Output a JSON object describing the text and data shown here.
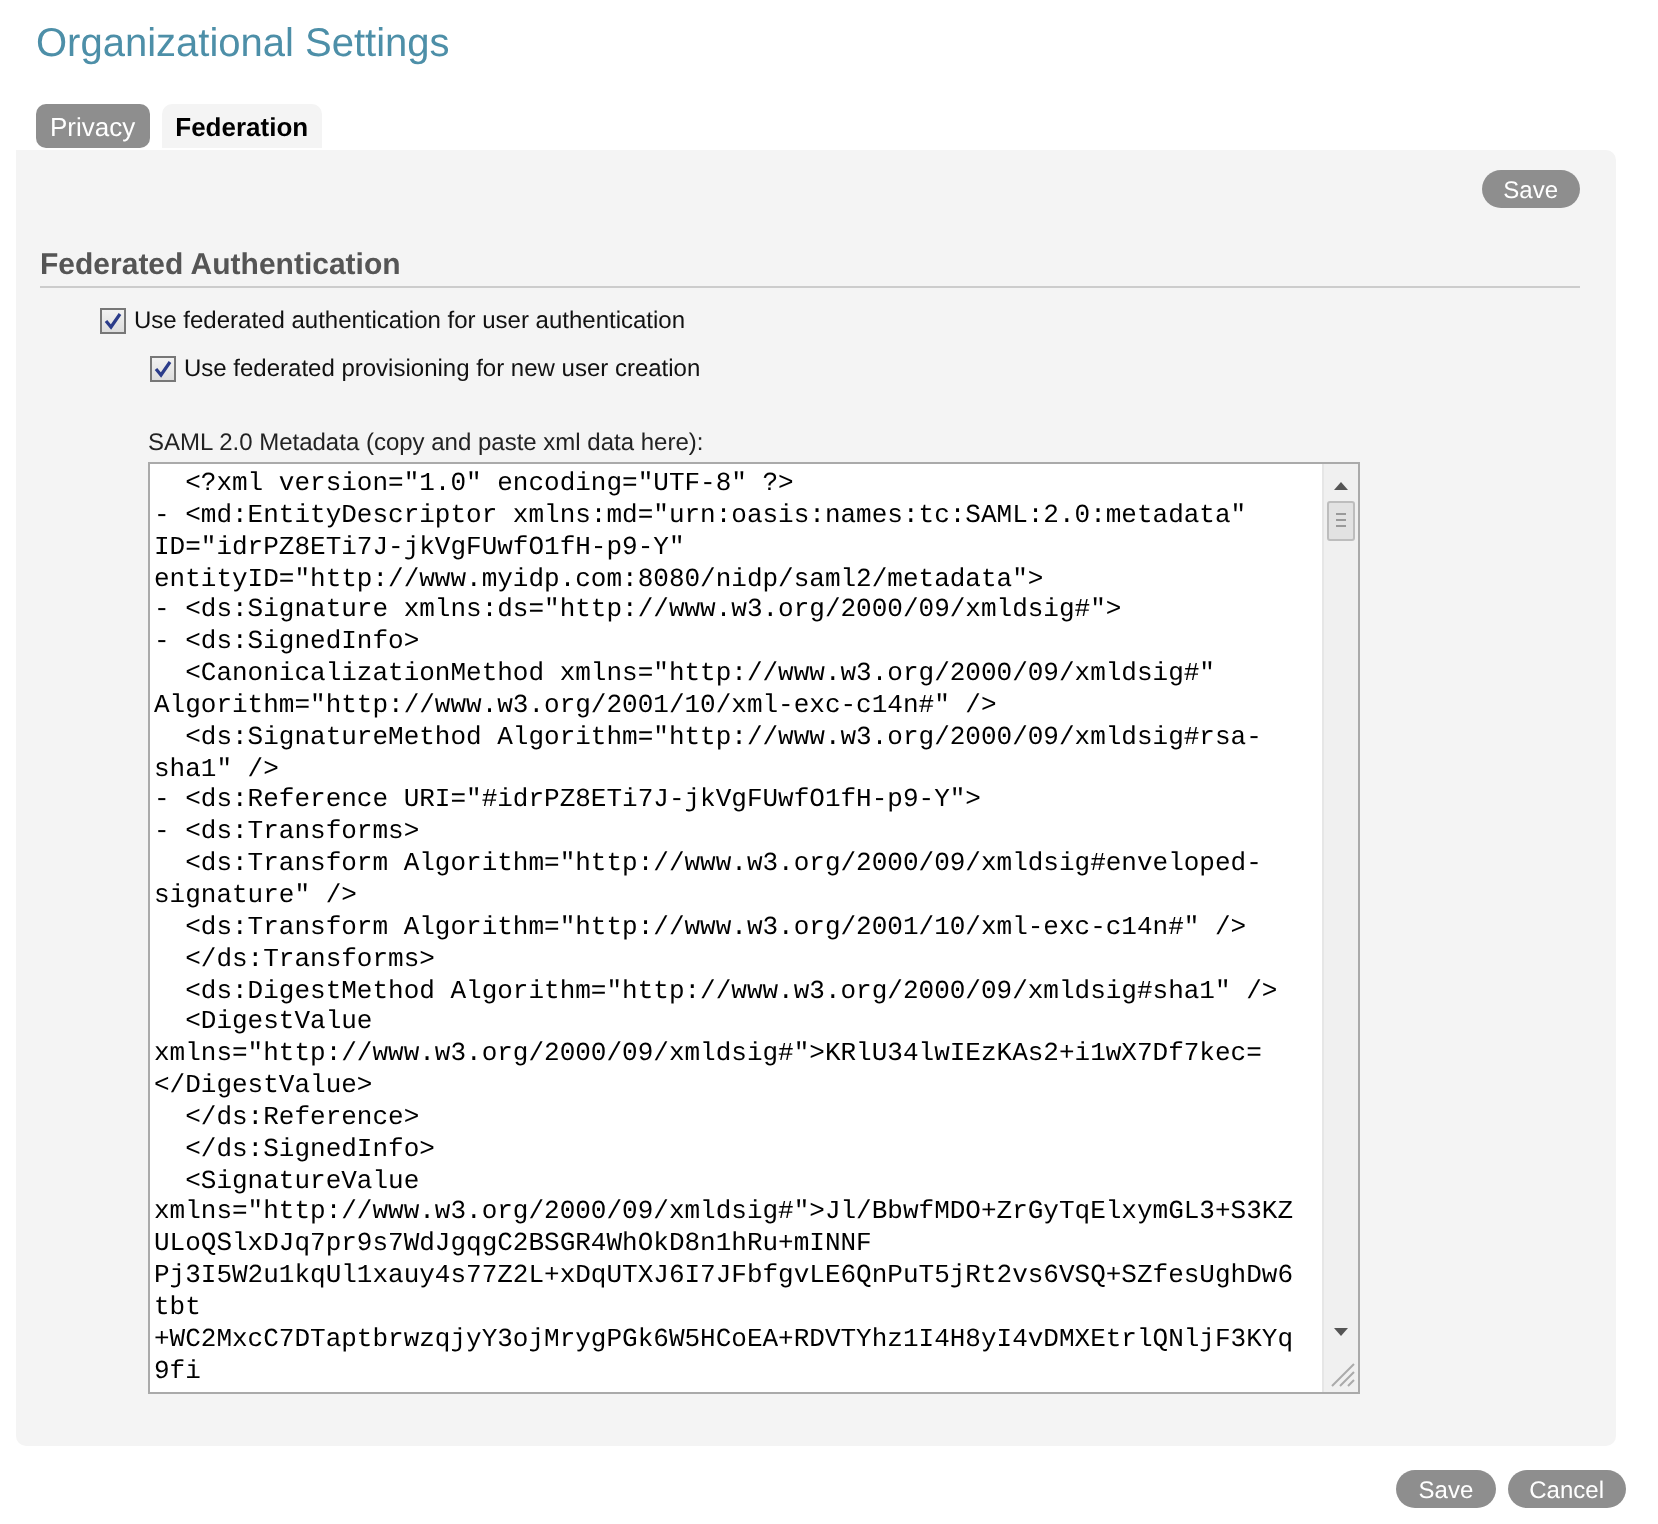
{
  "title": "Organizational Settings",
  "tabs": [
    {
      "label": "Privacy",
      "selected": false
    },
    {
      "label": "Federation",
      "selected": true
    }
  ],
  "panel_button": "Save",
  "section": {
    "heading": "Federated Authentication",
    "options": [
      {
        "label": "Use federated authentication for user authentication",
        "checked": true,
        "children": [
          {
            "label": "Use federated provisioning for new user creation",
            "checked": true
          }
        ]
      }
    ],
    "metadata_label": "SAML 2.0 Metadata (copy and paste xml data here):",
    "metadata_lines": [
      "  <?xml version=\"1.0\" encoding=\"UTF-8\" ?>",
      "- <md:EntityDescriptor xmlns:md=\"urn:oasis:names:tc:SAML:2.0:metadata\"",
      "ID=\"idrPZ8ETi7J-jkVgFUwfO1fH-p9-Y\"",
      "entityID=\"http://www.myidp.com:8080/nidp/saml2/metadata\">",
      "- <ds:Signature xmlns:ds=\"http://www.w3.org/2000/09/xmldsig#\">",
      "- <ds:SignedInfo>",
      "  <CanonicalizationMethod xmlns=\"http://www.w3.org/2000/09/xmldsig#\"",
      "Algorithm=\"http://www.w3.org/2001/10/xml-exc-c14n#\" />",
      "  <ds:SignatureMethod Algorithm=\"http://www.w3.org/2000/09/xmldsig#rsa-",
      "sha1\" />",
      "- <ds:Reference URI=\"#idrPZ8ETi7J-jkVgFUwfO1fH-p9-Y\">",
      "- <ds:Transforms>",
      "  <ds:Transform Algorithm=\"http://www.w3.org/2000/09/xmldsig#enveloped-",
      "signature\" />",
      "  <ds:Transform Algorithm=\"http://www.w3.org/2001/10/xml-exc-c14n#\" />",
      "  </ds:Transforms>",
      "  <ds:DigestMethod Algorithm=\"http://www.w3.org/2000/09/xmldsig#sha1\" />",
      "  <DigestValue",
      "xmlns=\"http://www.w3.org/2000/09/xmldsig#\">KRlU34lwIEzKAs2+i1wX7Df7kec=",
      "</DigestValue>",
      "  </ds:Reference>",
      "  </ds:SignedInfo>",
      "  <SignatureValue",
      "xmlns=\"http://www.w3.org/2000/09/xmldsig#\">Jl/BbwfMDO+ZrGyTqElxymGL3+S3KZ",
      "ULoQSlxDJq7pr9s7WdJgqgC2BSGR4WhOkD8n1hRu+mINNF",
      "Pj3I5W2u1kqUl1xauy4s77Z2L+xDqUTXJ6I7JFbfgvLE6QnPuT5jRt2vs6VSQ+SZfesUghDw6",
      "tbt",
      "+WC2MxcC7DTaptbrwzqjyY3ojMrygPGk6W5HCoEA+RDVTYhz1I4H8yI4vDMXEtrlQNljF3KYq",
      "9fi"
    ]
  },
  "footer_buttons": [
    "Save",
    "Cancel"
  ]
}
